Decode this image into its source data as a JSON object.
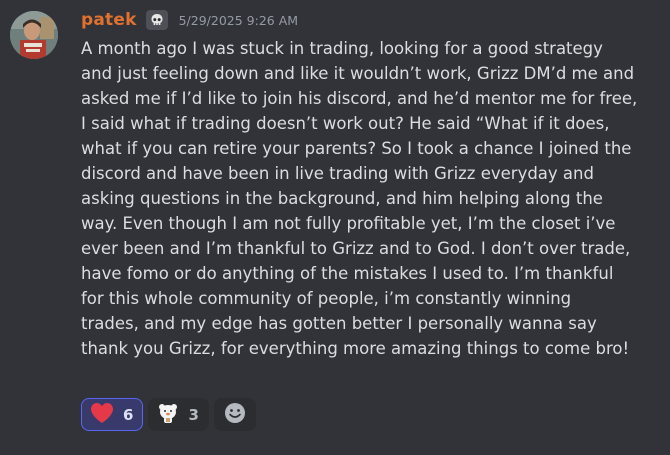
{
  "message": {
    "username": "patek",
    "role_icon": "skull-icon",
    "timestamp": "5/29/2025 9:26 AM",
    "text": "A month ago I was stuck in trading, looking for a good strategy\nand just feeling down and like it wouldn’t work, Grizz DM’d me and\nasked me if I’d like to join his discord, and he’d mentor me for free,\nI said what if trading doesn’t work out? He said “What if it does,\nwhat if you can retire your parents? So I took a chance I joined the\ndiscord and have been in live trading with Grizz everyday and\nasking questions in the background, and him helping along the\nway. Even though I am not fully profitable yet, I’m the closet i’ve\never been and I’m thankful to Grizz and to God. I don’t over trade,\nhave fomo or do anything of the mistakes I used to. I’m thankful\nfor this whole community of people, i’m constantly winning\ntrades, and my edge has gotten better I personally wanna say\nthank you Grizz, for everything more amazing things to come bro!",
    "reactions": [
      {
        "icon": "heart-icon",
        "count": "6",
        "selected": true,
        "color": "#e5394a"
      },
      {
        "icon": "bear-emoji-icon",
        "count": "3",
        "selected": false
      }
    ],
    "add_reaction_icon": "add-reaction-smiley-icon"
  },
  "colors": {
    "background": "#313338",
    "username": "#e0712f",
    "text": "#dbdee1",
    "timestamp": "#949ba4",
    "selected_reaction_bg": "#373a6b",
    "selected_reaction_border": "#5865f2"
  }
}
